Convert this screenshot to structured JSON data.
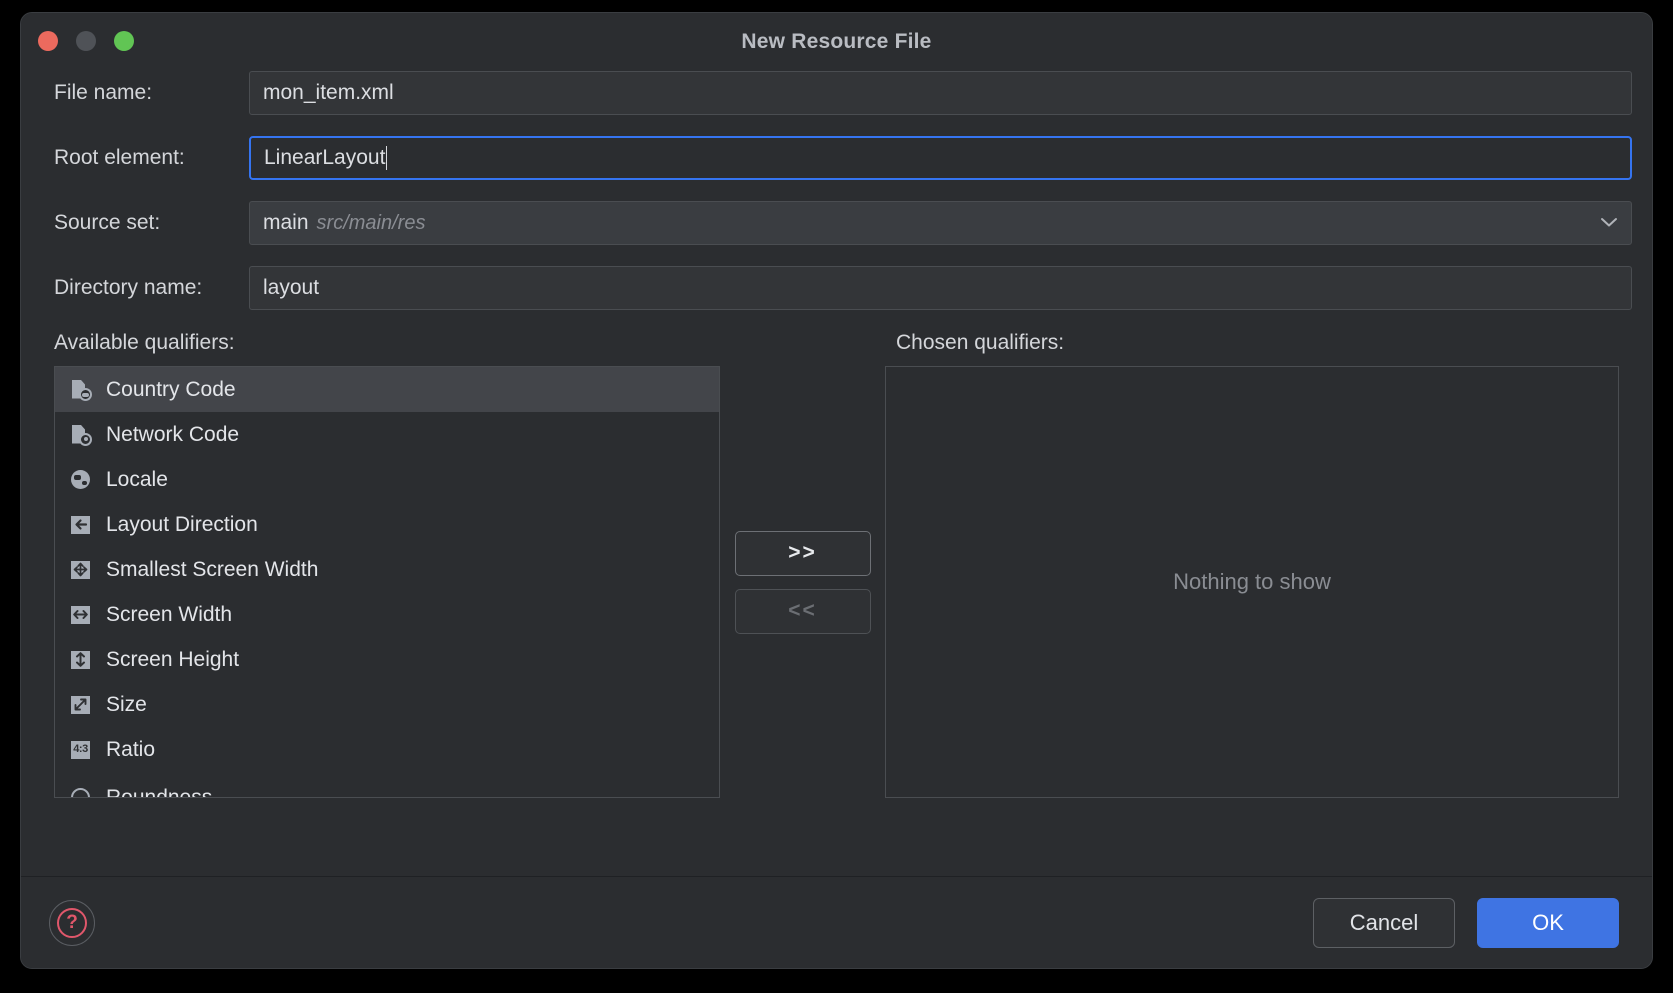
{
  "window": {
    "title": "New Resource File",
    "traffic_lights": [
      "close-button",
      "minimize-button",
      "maximize-button"
    ]
  },
  "form": {
    "file_name": {
      "label": "File name:",
      "value": "mon_item.xml"
    },
    "root_element": {
      "label": "Root element:",
      "value": "LinearLayout",
      "focused": true
    },
    "source_set": {
      "label": "Source set:",
      "value": "main",
      "path": "src/main/res",
      "chevron": "chevron-down-icon"
    },
    "directory_name": {
      "label": "Directory name:",
      "value": "layout"
    }
  },
  "qualifiers": {
    "available_label": "Available qualifiers:",
    "chosen_label": "Chosen qualifiers:",
    "available": [
      {
        "label": "Country Code",
        "icon": "document-globe-icon",
        "selected": true
      },
      {
        "label": "Network Code",
        "icon": "document-network-icon",
        "selected": false
      },
      {
        "label": "Locale",
        "icon": "globe-icon",
        "selected": false
      },
      {
        "label": "Layout Direction",
        "icon": "arrow-left-icon",
        "selected": false
      },
      {
        "label": "Smallest Screen Width",
        "icon": "four-way-arrow-icon",
        "selected": false
      },
      {
        "label": "Screen Width",
        "icon": "arrow-horizontal-icon",
        "selected": false
      },
      {
        "label": "Screen Height",
        "icon": "arrow-vertical-icon",
        "selected": false
      },
      {
        "label": "Size",
        "icon": "diagonal-arrow-icon",
        "selected": false
      },
      {
        "label": "Ratio",
        "icon": "aspect-ratio-icon",
        "selected": false
      },
      {
        "label": "Roundness",
        "icon": "roundness-icon",
        "selected": false
      }
    ],
    "chosen_empty_text": "Nothing to show",
    "add_button": {
      "label": ">>",
      "enabled": true
    },
    "remove_button": {
      "label": "<<",
      "enabled": false
    }
  },
  "footer": {
    "help": "?",
    "cancel": "Cancel",
    "ok": "OK"
  },
  "colors": {
    "accent": "#3f74e3",
    "focus_ring": "#3574f0",
    "help_red": "#e0576b",
    "window_bg": "#2b2d30",
    "field_bg": "#333538",
    "selected_row": "#43454a"
  }
}
